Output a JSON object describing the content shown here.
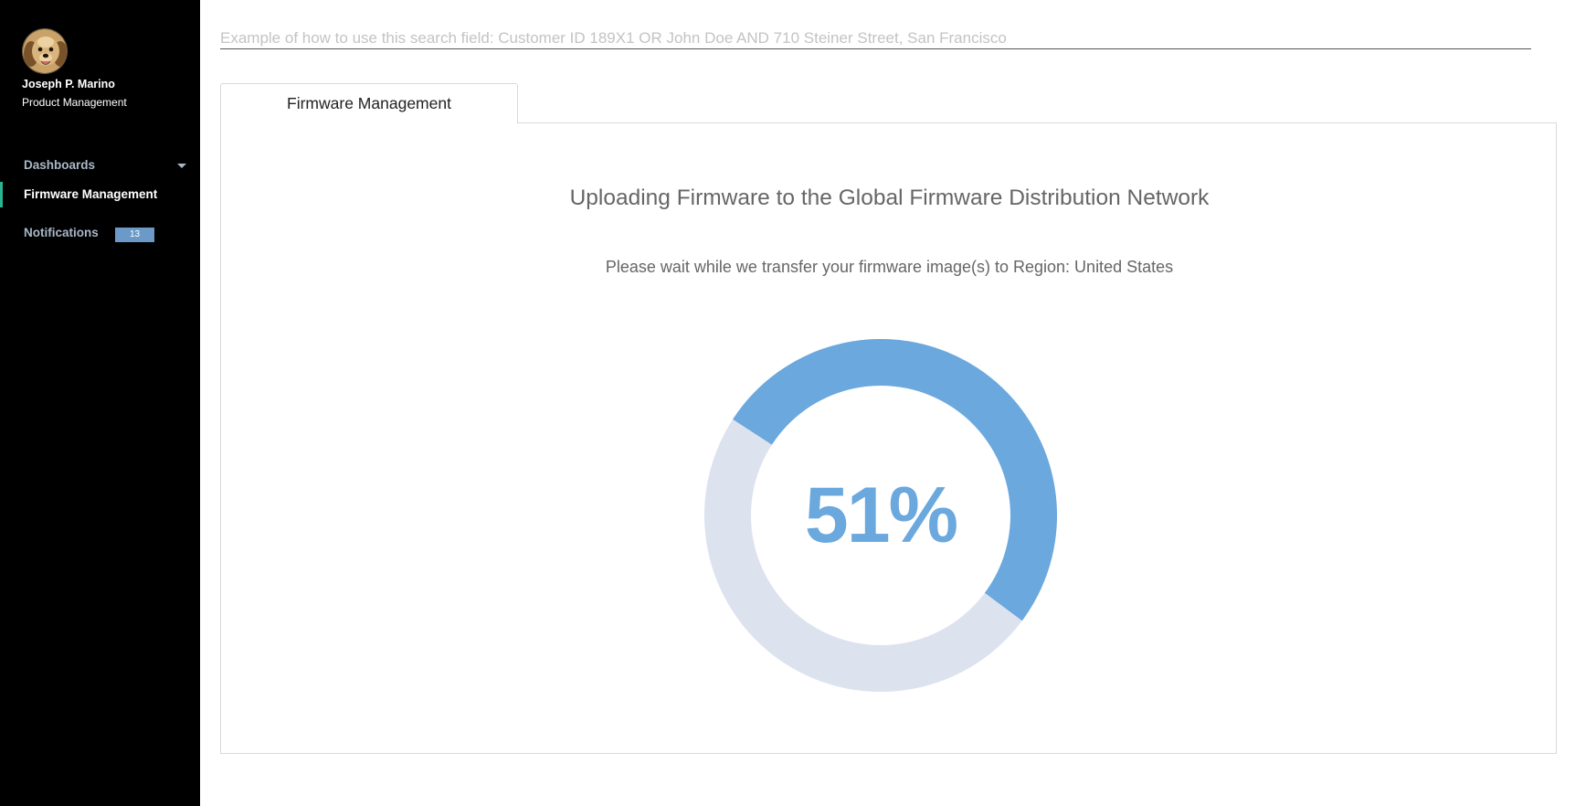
{
  "user": {
    "name": "Joseph P. Marino",
    "role": "Product Management",
    "avatar_icon": "dog-avatar"
  },
  "nav": {
    "items": [
      {
        "label": "Dashboards",
        "icon": "caret-down-icon"
      },
      {
        "label": "Firmware Management",
        "active": true
      },
      {
        "label": "Notifications",
        "badge": "13"
      }
    ]
  },
  "search": {
    "placeholder": "Example of how to use this search field: Customer ID 189X1 OR John Doe AND 710 Steiner Street, San Francisco",
    "value": ""
  },
  "tabs": [
    {
      "label": "Firmware Management",
      "active": true
    }
  ],
  "main": {
    "title": "Uploading Firmware to the Global Firmware Distribution Network",
    "subtitle": "Please wait while we transfer your firmware image(s) to Region: United States",
    "progress": {
      "percent": 51,
      "label": "51%"
    }
  },
  "colors": {
    "sidebar_bg": "#000000",
    "accent_green": "#2ab490",
    "progress_fill": "#6aa8de",
    "progress_track": "#dde2ef",
    "badge_bg": "#6b9ac8"
  }
}
